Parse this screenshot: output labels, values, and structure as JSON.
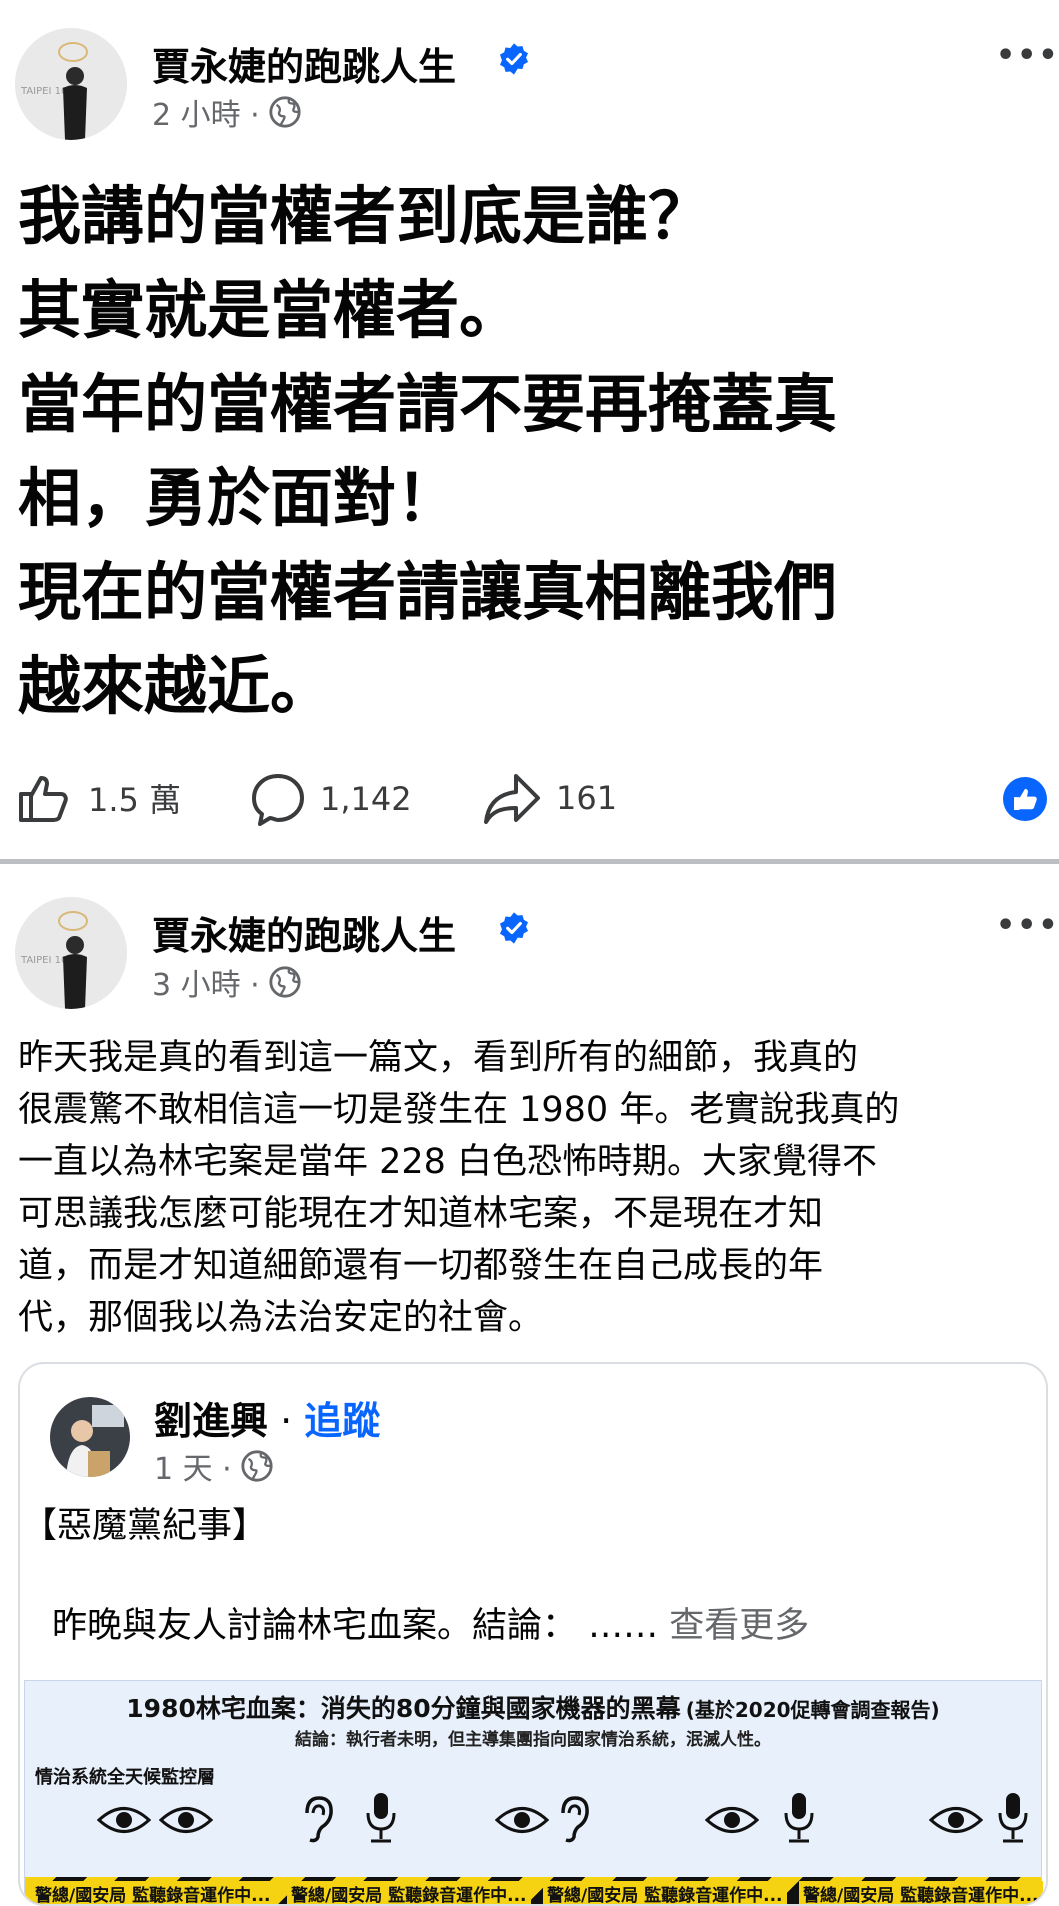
{
  "post1": {
    "author": "賈永婕的跑跳人生",
    "time": "2 小時 ·",
    "avatar_text": "TAIPEI 101",
    "lines": [
      "我講的當權者到底是誰？",
      "其實就是當權者。",
      "當年的當權者請不要再掩蓋真",
      "相，勇於面對！",
      "現在的當權者請讓真相離我們",
      "越來越近。"
    ],
    "likes": "1.5 萬",
    "comments": "1,142",
    "shares": "161"
  },
  "post2": {
    "author": "賈永婕的跑跳人生",
    "time": "3 小時 ·",
    "avatar_text": "TAIPEI 101",
    "lines": [
      "昨天我是真的看到這一篇文，看到所有的細節，我真的",
      "很震驚不敢相信這一切是發生在 1980 年。老實說我真的",
      "一直以為林宅案是當年 228 白色恐怖時期。大家覺得不",
      "可思議我怎麼可能現在才知道林宅案，不是現在才知",
      "道，而是才知道細節還有一切都發生在自己成長的年",
      "代，那個我以為法治安定的社會。"
    ]
  },
  "shared": {
    "author": "劉進興",
    "separator": " · ",
    "follow": "追蹤",
    "time": "1 天 ·",
    "heading": "【惡魔黨紀事】",
    "preview": "昨晚與友人討論林宅血案。結論： ……",
    "see_more": "查看更多"
  },
  "banner": {
    "title": "1980林宅血案：消失的80分鐘與國家機器的黑幕",
    "title_note": "(基於2020促轉會調查報告)",
    "subtitle": "結論：執行者未明，但主導集團指向國家情治系統，泯滅人性。",
    "layer_label": "情治系統全天候監控層",
    "tape_text": "警總/國安局 監聽錄音運作中..."
  },
  "icons": {
    "verified": "verified-badge-icon",
    "globe": "globe-icon",
    "more": "more-options-icon",
    "like": "like-icon",
    "comment": "comment-icon",
    "share": "share-icon",
    "reaction": "like-reaction-icon",
    "eye": "eye-icon",
    "ear": "ear-icon",
    "mic": "microphone-icon"
  },
  "colors": {
    "verified": "#0866ff",
    "link": "#0866ff",
    "muted": "#65676b",
    "tape_yellow": "#f5d312"
  }
}
